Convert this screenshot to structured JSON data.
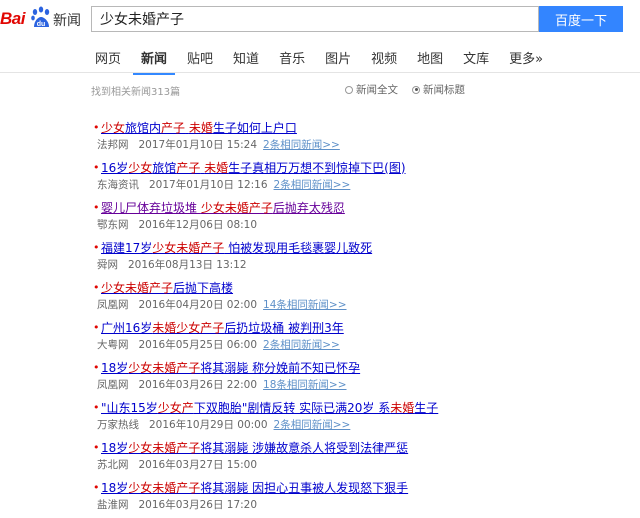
{
  "header": {
    "logo_prefix": "Bai",
    "logo_paw": "du",
    "logo_suffix": "新闻",
    "query": "少女未婚产子",
    "search_button": "百度一下"
  },
  "nav": {
    "tabs": [
      "网页",
      "新闻",
      "贴吧",
      "知道",
      "音乐",
      "图片",
      "视频",
      "地图",
      "文库",
      "更多»"
    ],
    "active": 1
  },
  "stats": "找到相关新闻313篇",
  "options": [
    {
      "label": "新闻全文",
      "selected": false
    },
    {
      "label": "新闻标题",
      "selected": true
    }
  ],
  "results": [
    {
      "title": [
        [
          "少女",
          true
        ],
        [
          "旅馆内",
          false
        ],
        [
          "产子",
          true
        ],
        [
          " ",
          false
        ],
        [
          "未婚",
          true
        ],
        [
          "生子如何上户口",
          false
        ]
      ],
      "visited": false,
      "source": "法邦网",
      "time": "2017年01月10日 15:24",
      "same": "2条相同新闻>>"
    },
    {
      "title": [
        [
          "16岁",
          false
        ],
        [
          "少女",
          true
        ],
        [
          "旅馆",
          false
        ],
        [
          "产子",
          true
        ],
        [
          " ",
          false
        ],
        [
          "未婚",
          true
        ],
        [
          "生子真相万万想不到惊掉下巴(图)",
          false
        ]
      ],
      "visited": false,
      "source": "东海资讯",
      "time": "2017年01月10日 12:16",
      "same": "2条相同新闻>>"
    },
    {
      "title": [
        [
          "婴儿尸体弃垃圾堆 ",
          false
        ],
        [
          "少女未婚产子",
          true
        ],
        [
          "后抛弃太残忍",
          false
        ]
      ],
      "visited": true,
      "source": "鄂东网",
      "time": "2016年12月06日 08:10",
      "same": ""
    },
    {
      "title": [
        [
          "福建17岁",
          false
        ],
        [
          "少女未婚产子",
          true
        ],
        [
          " 怕被发现用毛毯裹婴儿致死",
          false
        ]
      ],
      "visited": false,
      "source": "舜网",
      "time": "2016年08月13日 13:12",
      "same": ""
    },
    {
      "title": [
        [
          "少女未婚产子",
          true
        ],
        [
          "后抛下高楼",
          false
        ]
      ],
      "visited": false,
      "source": "凤凰网",
      "time": "2016年04月20日 02:00",
      "same": "14条相同新闻>>"
    },
    {
      "title": [
        [
          "广州16岁",
          false
        ],
        [
          "未婚少女产子",
          true
        ],
        [
          "后扔垃圾桶 被判刑3年",
          false
        ]
      ],
      "visited": false,
      "source": "大粤网",
      "time": "2016年05月25日 06:00",
      "same": "2条相同新闻>>"
    },
    {
      "title": [
        [
          "18岁",
          false
        ],
        [
          "少女未婚产子",
          true
        ],
        [
          "将其溺毙 称分娩前不知已怀孕",
          false
        ]
      ],
      "visited": false,
      "source": "凤凰网",
      "time": "2016年03月26日 22:00",
      "same": "18条相同新闻>>"
    },
    {
      "title": [
        [
          "\"山东15岁",
          false
        ],
        [
          "少女产",
          true
        ],
        [
          "下双胞胎\"剧情反转 实际已满20岁 系",
          false
        ],
        [
          "未婚",
          true
        ],
        [
          "生子",
          false
        ]
      ],
      "visited": false,
      "source": "万家热线",
      "time": "2016年10月29日 00:00",
      "same": "2条相同新闻>>"
    },
    {
      "title": [
        [
          "18岁",
          false
        ],
        [
          "少女未婚产子",
          true
        ],
        [
          "将其溺毙 涉嫌故意杀人将受到法律严惩",
          false
        ]
      ],
      "visited": false,
      "source": "苏北网",
      "time": "2016年03月27日 15:00",
      "same": ""
    },
    {
      "title": [
        [
          "18岁",
          false
        ],
        [
          "少女未婚产子",
          true
        ],
        [
          "将其溺毙 因担心丑事被人发现怒下狠手",
          false
        ]
      ],
      "visited": false,
      "source": "盐淮网",
      "time": "2016年03月26日 17:20",
      "same": ""
    }
  ],
  "colors": {
    "brand_red": "#e10602",
    "search_blue": "#3385ff",
    "link_blue": "#0000cc",
    "highlight_red": "#cc0000",
    "visited_purple": "#660099"
  }
}
